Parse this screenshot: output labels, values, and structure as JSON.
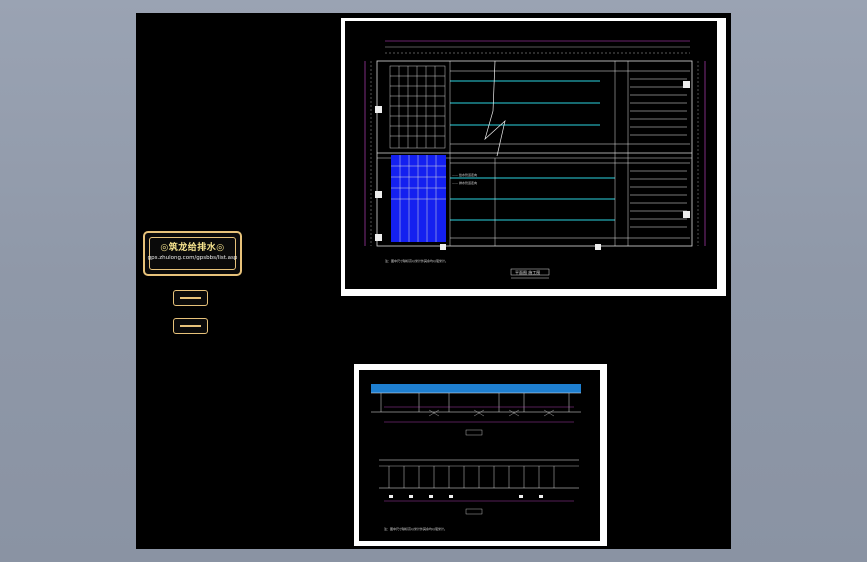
{
  "logo": {
    "title": "◎筑龙给排水◎",
    "url": "gps.zhulong.com/gpsbbs/list.asp"
  },
  "plan_sheet": {
    "title": "平面图 施工图",
    "note": "注：图中尺寸除标高以米计外其余均以毫米计。",
    "legend_items": [
      "—— 给水管道走向",
      "—— 排水管道走向"
    ]
  },
  "elevation_sheet": {
    "note": "注：图中尺寸除标高以米计外其余均以毫米计。"
  },
  "colors": {
    "background": "#8f98a8",
    "canvas": "#000000",
    "sheet_frame": "#ffffff",
    "cyan_lines": "#2bd3e0",
    "magenta_dims": "#d34bd8",
    "blue_area": "#1420f0",
    "stamp_border": "#e7c27a"
  }
}
